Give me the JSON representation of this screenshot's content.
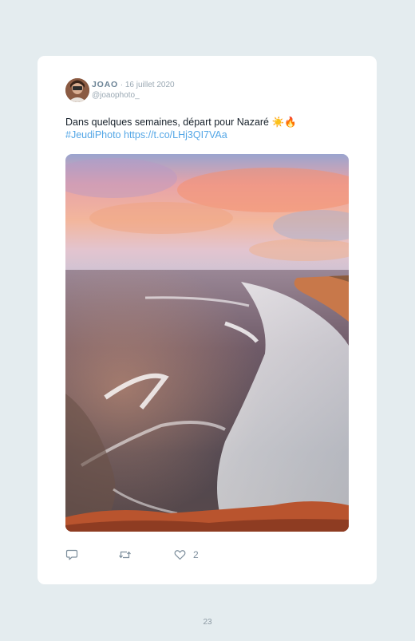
{
  "tweet": {
    "author_name": "JOAO",
    "separator": " · ",
    "date": "16 juillet 2020",
    "handle": "@joaophoto_",
    "text": "Dans quelques semaines, départ pour Nazaré ☀️🔥",
    "hashtag": "#JeudiPhoto",
    "url": "https://t.co/LHj3QI7VAa",
    "likes": "2",
    "image_alt": "Photo of waves breaking on a beach under a pink and orange sunset sky"
  },
  "icons": {
    "reply": "speech-bubble-icon",
    "retweet": "retweet-icon",
    "like": "heart-icon"
  },
  "colors": {
    "background": "#e4ecef",
    "card": "#ffffff",
    "link": "#53a6e6",
    "name": "#6a8295",
    "meta": "#9aa8b3"
  },
  "page": {
    "number": "23"
  }
}
